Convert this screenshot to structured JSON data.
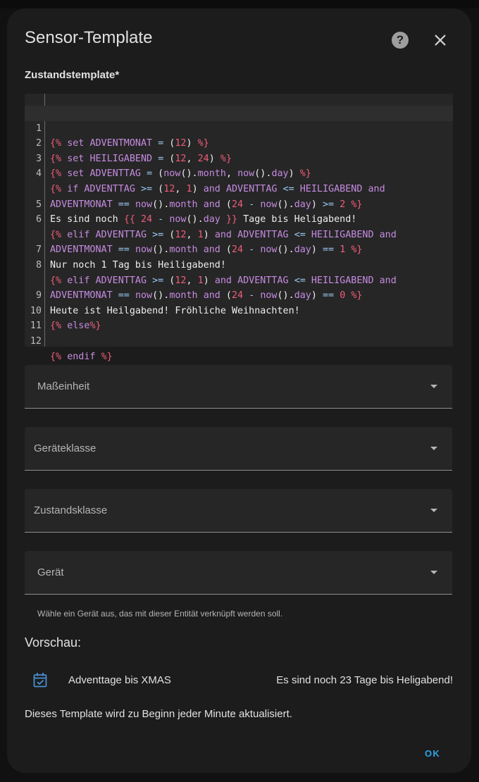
{
  "dialog": {
    "title": "Sensor-Template",
    "help_icon": "help-circle-icon",
    "close_icon": "close-icon"
  },
  "state_template": {
    "label": "Zustandstemplate*",
    "lines": [
      {
        "n": "1"
      },
      {
        "n": "2"
      },
      {
        "n": "3"
      },
      {
        "n": "4"
      },
      {
        "n": ""
      },
      {
        "n": "5"
      },
      {
        "n": "6"
      },
      {
        "n": ""
      },
      {
        "n": "7"
      },
      {
        "n": "8"
      },
      {
        "n": ""
      },
      {
        "n": "9"
      },
      {
        "n": "10"
      },
      {
        "n": "11"
      },
      {
        "n": "12"
      }
    ]
  },
  "fields": {
    "unit": "Maßeinheit",
    "device_class": "Geräteklasse",
    "state_class": "Zustandsklasse",
    "device": "Gerät",
    "device_helper": "Wähle ein Gerät aus, das mit dieser Entität verknüpft werden soll."
  },
  "preview": {
    "heading": "Vorschau:",
    "icon": "calendar-check-icon",
    "entity_name": "Adventtage bis XMAS",
    "state": "Es sind noch 23 Tage bis Heligabend!",
    "update_note": "Dieses Template wird zu Beginn jeder Minute aktualisiert."
  },
  "actions": {
    "ok_label": "OK"
  },
  "colors": {
    "dialog_bg": "#1c1c1c",
    "editor_bg": "#262626",
    "jinja_delimiter": "#ef5d7a",
    "keyword": "#c58be0",
    "operator": "#9cc9f5",
    "accent": "#2fa3e6"
  }
}
